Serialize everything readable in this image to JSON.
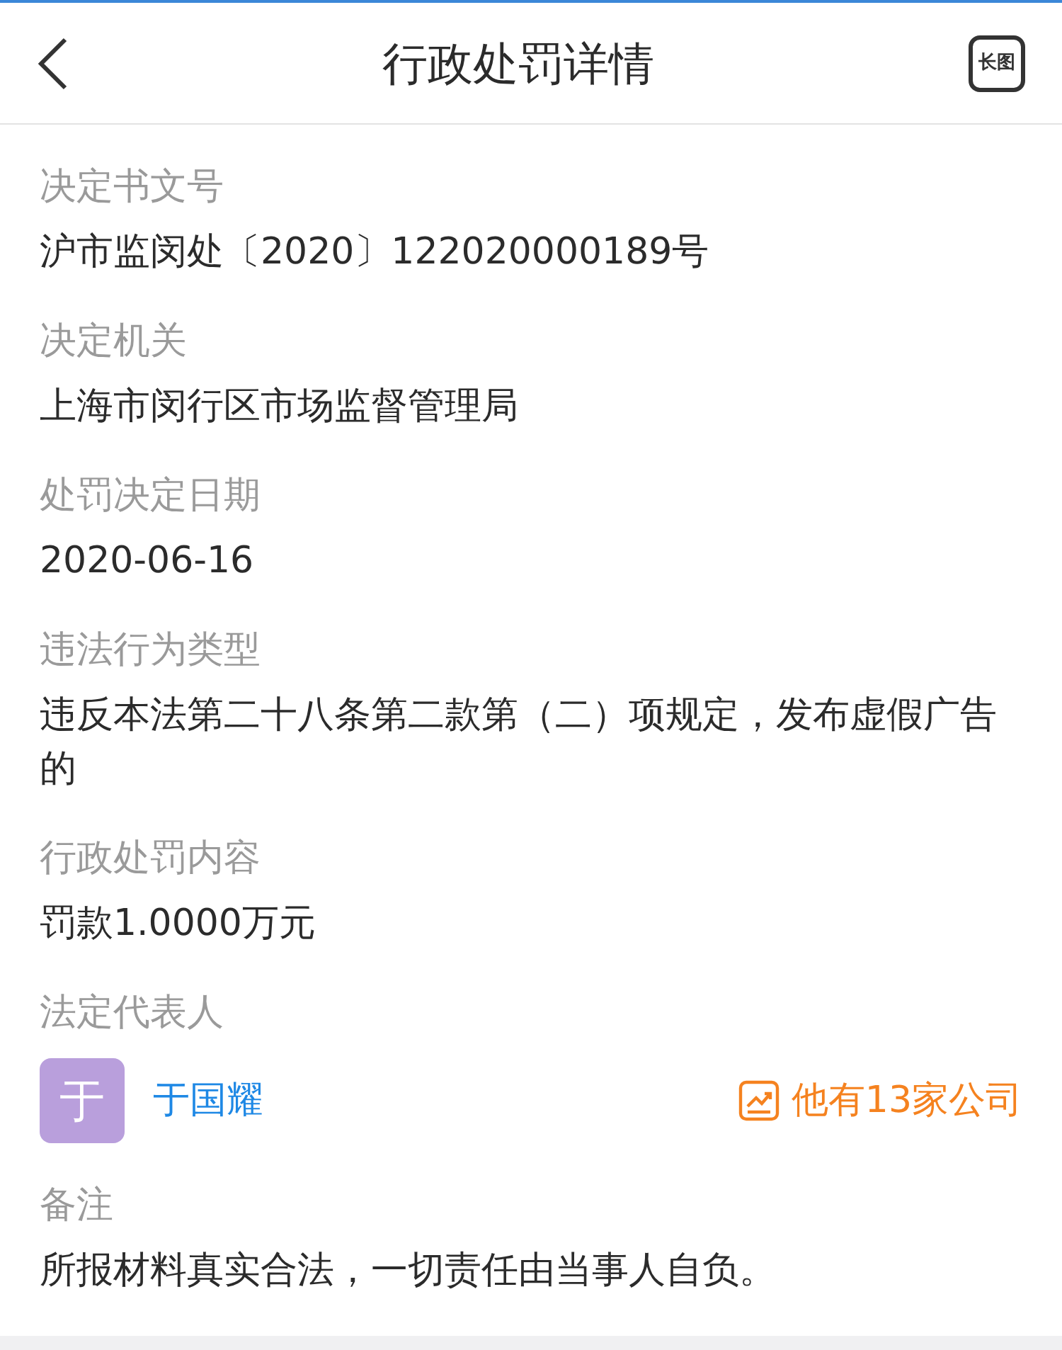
{
  "header": {
    "title": "行政处罚详情",
    "long_image_label": "长图"
  },
  "fields": [
    {
      "kind": "text",
      "label": "决定书文号",
      "value": "沪市监闵处〔2020〕122020000189号"
    },
    {
      "kind": "text",
      "label": "决定机关",
      "value": "上海市闵行区市场监督管理局"
    },
    {
      "kind": "text",
      "label": "处罚决定日期",
      "value": "2020-06-16"
    },
    {
      "kind": "text",
      "label": "违法行为类型",
      "value": "违反本法第二十八条第二款第（二）项规定，发布虚假广告的"
    },
    {
      "kind": "text",
      "label": "行政处罚内容",
      "value": "罚款1.0000万元"
    },
    {
      "kind": "person",
      "label": "法定代表人",
      "avatar": "于",
      "name": "于国耀",
      "companies": "他有13家公司"
    },
    {
      "kind": "text",
      "label": "备注",
      "value": "所报材料真实合法，一切责任由当事人自负。"
    }
  ]
}
